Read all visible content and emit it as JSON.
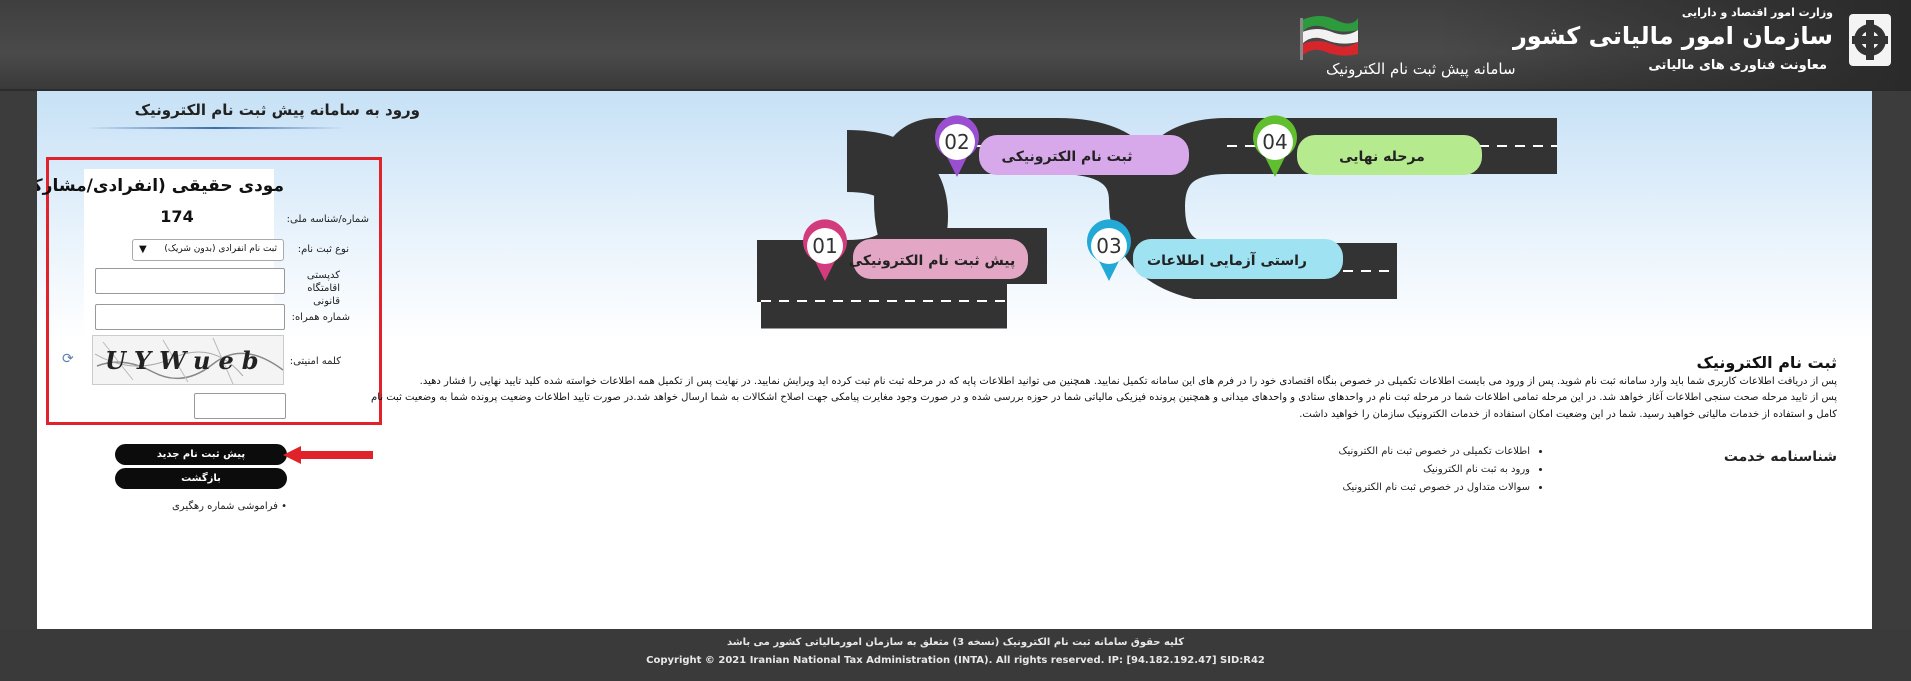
{
  "header": {
    "ministry": "وزارت امور اقتصاد و دارایی",
    "org_title": "سازمان امور مالیاتی کشور",
    "deputy": "معاونت فناوری های مالیاتی",
    "system_title": "سامانه پیش ثبت نام الکترونیک"
  },
  "login": {
    "title": "ورود به سامانه پیش ثبت نام الکترونیک",
    "person_type": "مودی حقیقی (انفرادی/مشارکت)",
    "tin_label": "شماره/شناسه ملی:",
    "tin_value": "174",
    "reg_type_label": "نوع ثبت نام:",
    "reg_type_value": "ثبت نام انفرادی (بدون شریک)",
    "postal_label": "کدپستی اقامتگاه قانونی",
    "mobile_label": "شماره همراه:",
    "captcha_label": "کلمه امنیتی:",
    "captcha_text": "UYWueb",
    "new_button": "پیش ثبت نام جدید",
    "back_button": "بازگشت",
    "forgot_link": "فراموشی شماره رهگیری"
  },
  "steps": [
    {
      "num": "01",
      "label": "پیش ثبت نام الکترونیکی"
    },
    {
      "num": "02",
      "label": "ثبت نام الکترونیکی"
    },
    {
      "num": "03",
      "label": "راستی آزمایی اطلاعات"
    },
    {
      "num": "04",
      "label": "مرحله نهایی"
    }
  ],
  "info": {
    "title": "ثبت نام الکترونیک",
    "paragraphs": [
      "پس از دریافت اطلاعات کاربری شما باید وارد سامانه ثبت نام شوید. پس از ورود می بایست اطلاعات تکمیلی در خصوص بنگاه اقتصادی خود را در فرم های این سامانه تکمیل نمایید. همچنین می توانید اطلاعات پایه که در مرحله ثبت نام ثبت کرده اید ویرایش نمایید. در نهایت پس از تکمیل همه اطلاعات خواسته شده کلید تایید نهایی را فشار دهید.",
      "پس از تایید مرحله صحت سنجی اطلاعات آغاز خواهد شد. در این مرحله تمامی اطلاعات شما در مرحله ثبت نام در واحدهای ستادی و واحدهای میدانی و همچنین پرونده فیزیکی مالیاتی شما در حوزه بررسی شده و در صورت وجود مغایرت پیامکی جهت اصلاح اشکالات به شما ارسال خواهد شد.در صورت تایید اطلاعات وضعیت پرونده شما به وضعیت ثبت نام",
      "کامل و استفاده از خدمات مالیاتی خواهید رسید. شما در این وضعیت امکان استفاده از خدمات الکترونیک سازمان را خواهید داشت."
    ],
    "service_title": "شناسنامه خدمت",
    "links": [
      "اطلاعات تکمیلی در خصوص ثبت نام الکترونیک",
      "ورود به ثبت نام الکترونیک",
      "سوالات متداول در خصوص ثبت نام الکترونیک"
    ]
  },
  "footer": {
    "line1": "کلیه حقوق سامانه ثبت نام الکترونیک (نسخه 3) متعلق به سازمان امورمالیاتی کشور می باشد",
    "line2": "Copyright © 2021 Iranian National Tax Administration (INTA). All rights reserved. IP: [94.182.192.47] SID:R42"
  },
  "colors": {
    "highlight_border": "#e0222a",
    "step1": "#e3a7c5",
    "step2": "#d7a8ea",
    "step3": "#9fe3f3",
    "step4": "#b6ea8e"
  }
}
